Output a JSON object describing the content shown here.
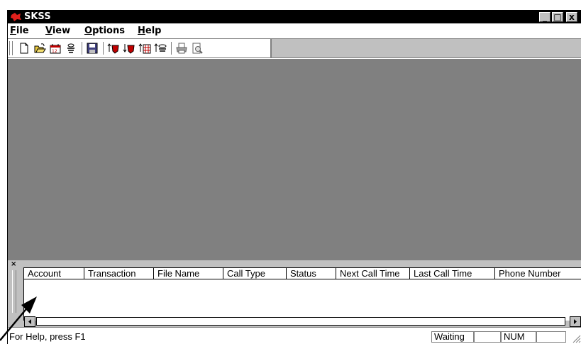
{
  "window": {
    "title": "SKSS"
  },
  "menu": [
    {
      "label": "File",
      "mnemonic": "F",
      "rest": "ile"
    },
    {
      "label": "View",
      "mnemonic": "V",
      "rest": "iew"
    },
    {
      "label": "Options",
      "mnemonic": "O",
      "rest": "ptions"
    },
    {
      "label": "Help",
      "mnemonic": "H",
      "rest": "elp"
    }
  ],
  "toolbar": {
    "icons": [
      "new-file-icon",
      "open-folder-icon",
      "calendar-icon",
      "properties-icon",
      "save-icon",
      "call-start-icon",
      "call-stop-icon",
      "schedule-icon",
      "queue-icon",
      "print-icon",
      "print-preview-icon"
    ]
  },
  "list": {
    "columns": [
      "Account",
      "Transaction",
      "File Name",
      "Call Type",
      "Status",
      "Next Call Time",
      "Last Call Time",
      "Phone Number"
    ]
  },
  "statusbar": {
    "help_text": "For Help, press F1",
    "state": "Waiting",
    "num": "NUM"
  },
  "colors": {
    "client_area": "#808080",
    "chrome": "#c0c0c0",
    "titlebar": "#000000"
  }
}
